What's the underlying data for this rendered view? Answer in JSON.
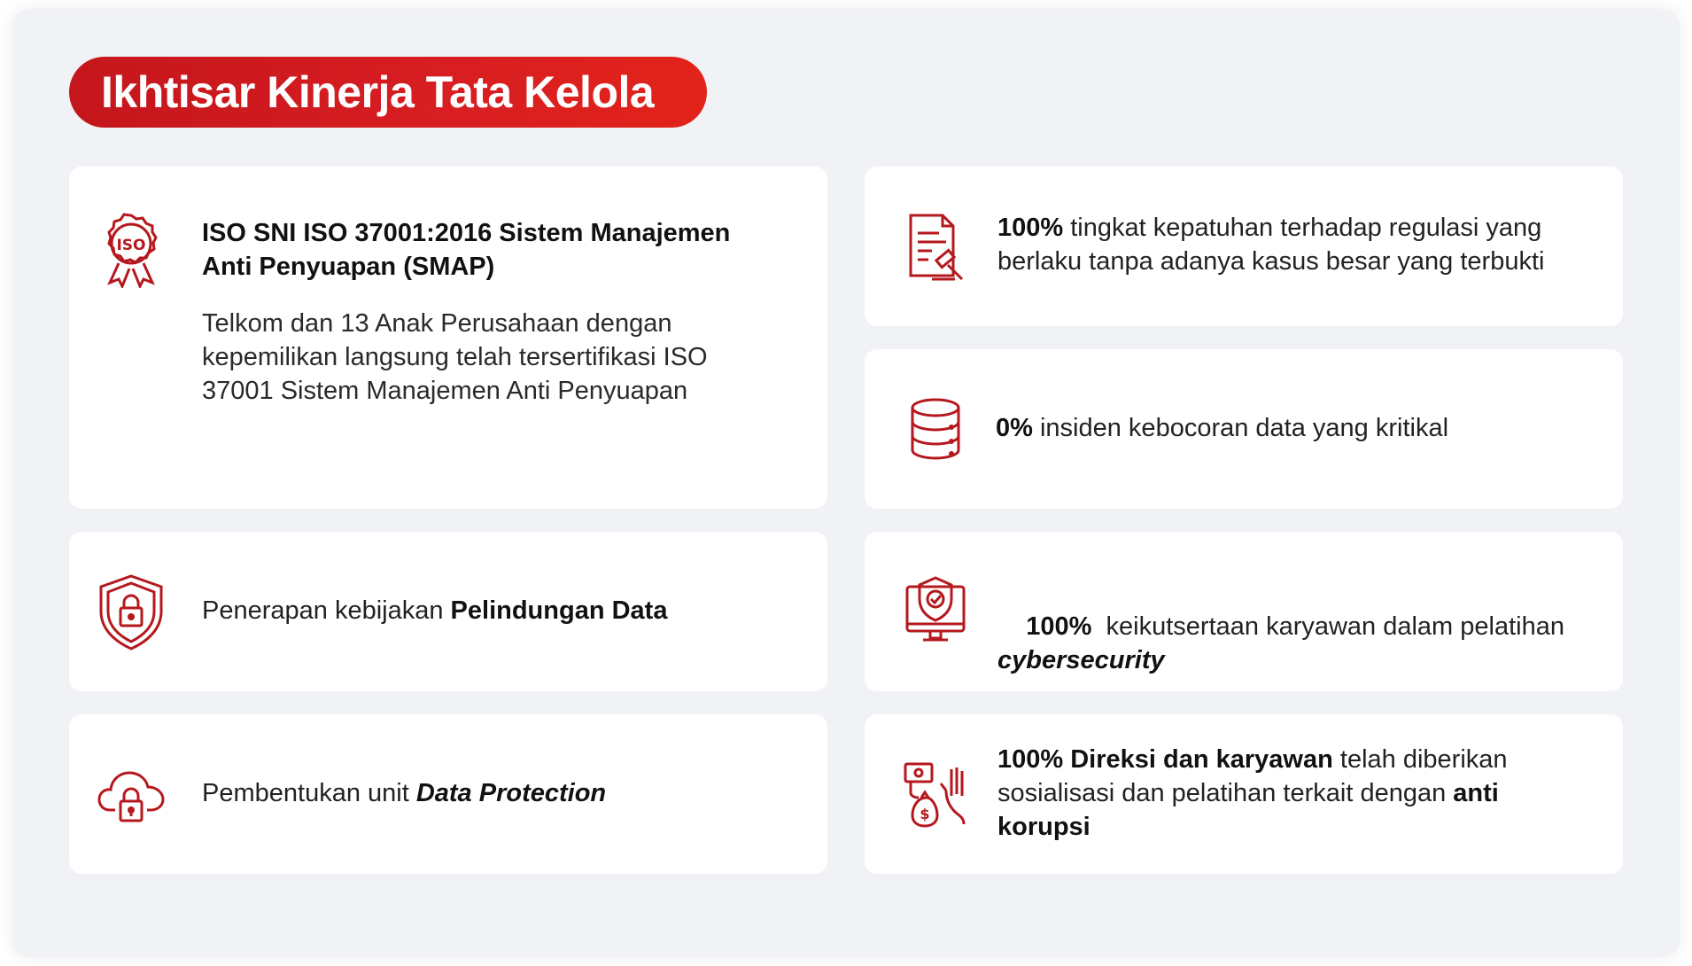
{
  "title": "Ikhtisar Kinerja Tata Kelola",
  "colors": {
    "accent": "#c4161c",
    "icon": "#b5181d",
    "background": "#f1f2f6",
    "card": "#ffffff"
  },
  "cards": {
    "iso": {
      "icon": "iso-seal-icon",
      "heading": "ISO SNI ISO 37001:2016 Sistem Manajemen Anti Penyuapan (SMAP)",
      "description": "Telkom dan 13 Anak Perusahaan dengan kepemilikan langsung telah tersertifikasi ISO 37001 Sistem Manajemen Anti Penyuapan"
    },
    "compliance": {
      "icon": "legal-document-icon",
      "bold": "100%",
      "text": " tingkat kepatuhan terhadap regulasi yang berlaku tanpa adanya kasus besar yang terbukti"
    },
    "data_leak": {
      "icon": "database-icon",
      "bold": "0%",
      "text": " insiden kebocoran data yang kritikal"
    },
    "data_policy": {
      "icon": "shield-lock-icon",
      "text": "Penerapan kebijakan ",
      "bold": "Pelindungan Data"
    },
    "cyber_training": {
      "icon": "monitor-shield-icon",
      "bold": "100%",
      "text": "  keikutsertaan karyawan dalam pelatihan ",
      "italic": "cybersecurity"
    },
    "data_unit": {
      "icon": "cloud-lock-icon",
      "text": "Pembentukan unit ",
      "italic": "Data Protection"
    },
    "anti_corruption": {
      "icon": "refuse-bribe-icon",
      "bold1": "100% Direksi dan karyawan",
      "text": " telah diberikan sosialisasi dan pelatihan terkait dengan ",
      "bold2": "anti korupsi"
    }
  }
}
